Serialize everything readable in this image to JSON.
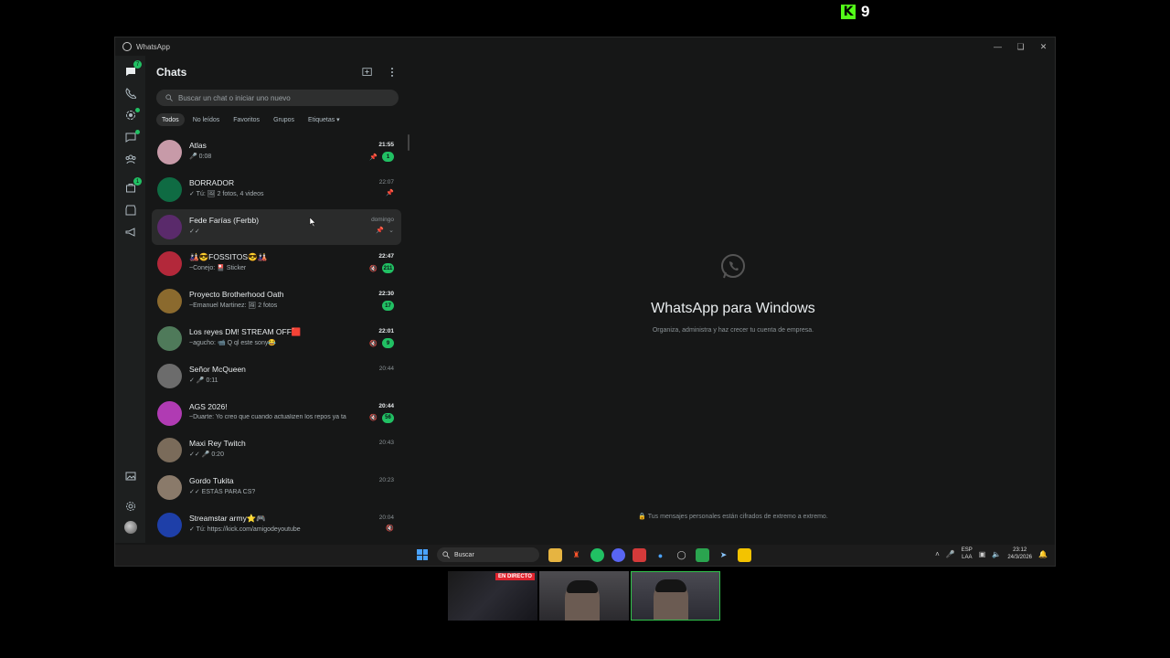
{
  "overlay": {
    "kick_viewers": "9"
  },
  "window": {
    "title": "WhatsApp"
  },
  "rail": {
    "chats_badge": "7",
    "updates_badge": "1"
  },
  "chatlist": {
    "title": "Chats",
    "search_placeholder": "Buscar un chat o iniciar uno nuevo",
    "filters": [
      "Todos",
      "No leídos",
      "Favoritos",
      "Grupos",
      "Etiquetas"
    ],
    "chats": [
      {
        "name": "Atlas",
        "preview": "🎤 0:08",
        "time": "21:55",
        "unread": "1",
        "pinned": true,
        "muted": false,
        "bold_time": true,
        "avatar": "#c79aa8"
      },
      {
        "name": "BORRADOR",
        "preview": "✓ Tú: 🖼 2 fotos, 4 videos",
        "time": "22:07",
        "unread": "",
        "pinned": true,
        "muted": false,
        "bold_time": false,
        "avatar": "#0f6b43"
      },
      {
        "name": "Fede Farías (Ferbb)",
        "preview": "✓✓",
        "time": "domingo",
        "unread": "",
        "pinned": true,
        "muted": false,
        "bold_time": false,
        "avatar": "#5a2a6b"
      },
      {
        "name": "🎎😎FOSSITOS😎🎎",
        "preview": "~Conejo: 🎴 Sticker",
        "time": "22:47",
        "unread": "211",
        "pinned": false,
        "muted": true,
        "bold_time": true,
        "avatar": "#b3283a"
      },
      {
        "name": "Proyecto Brotherhood Oath",
        "preview": "~Emanuel Martinez: 🖼 2 fotos",
        "time": "22:30",
        "unread": "17",
        "pinned": false,
        "muted": false,
        "bold_time": true,
        "avatar": "#8b6a2e"
      },
      {
        "name": "Los reyes DM! STREAM OFF🟥",
        "preview": "~agucho: 📹 Q ql este sony😂",
        "time": "22:01",
        "unread": "9",
        "pinned": false,
        "muted": true,
        "bold_time": true,
        "avatar": "#4f7a5a"
      },
      {
        "name": "Señor McQueen",
        "preview": "✓ 🎤 0:11",
        "time": "20:44",
        "unread": "",
        "pinned": false,
        "muted": false,
        "bold_time": false,
        "avatar": "#6c6c6c"
      },
      {
        "name": "AGS 2026!",
        "preview": "~Duarte: Yo creo que cuando actualizen los repos ya ta",
        "time": "20:44",
        "unread": "56",
        "pinned": false,
        "muted": true,
        "bold_time": true,
        "avatar": "#b03bb3"
      },
      {
        "name": "Maxi Rey Twitch",
        "preview": "✓✓ 🎤 0:20",
        "time": "20:43",
        "unread": "",
        "pinned": false,
        "muted": false,
        "bold_time": false,
        "avatar": "#7a6b5a"
      },
      {
        "name": "Gordo Tukita",
        "preview": "✓✓ ESTÁS PARA CS?",
        "time": "20:23",
        "unread": "",
        "pinned": false,
        "muted": false,
        "bold_time": false,
        "avatar": "#8a7a6a"
      },
      {
        "name": "Streamstar army⭐🎮",
        "preview": "✓ Tú: https://kick.com/amigodeyoutube",
        "time": "20:04",
        "unread": "",
        "pinned": false,
        "muted": true,
        "bold_time": false,
        "avatar": "#1e3fa8"
      }
    ]
  },
  "main": {
    "title": "WhatsApp para Windows",
    "subtitle": "Organiza, administra y haz crecer tu cuenta de empresa.",
    "encryption": "Tus mensajes personales están cifrados de extremo a extremo."
  },
  "taskbar": {
    "search": "Buscar",
    "lang_top": "ESP",
    "lang_bottom": "LAA",
    "time": "23:12",
    "date": "24/3/2026"
  },
  "stream": {
    "live_label": "EN DIRECTO"
  }
}
